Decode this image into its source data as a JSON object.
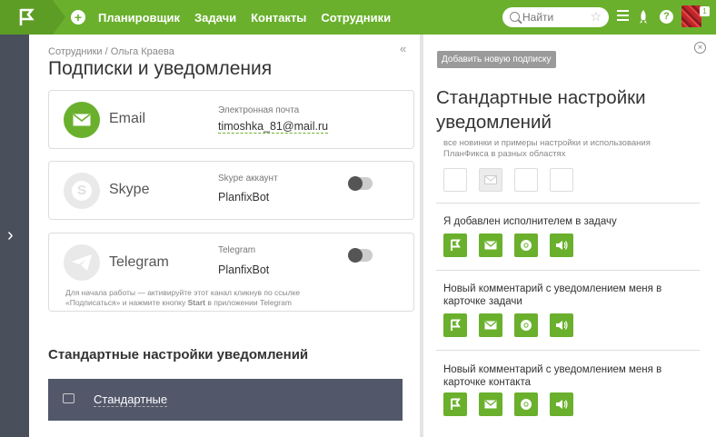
{
  "nav": {
    "items": [
      {
        "label": "Планировщик"
      },
      {
        "label": "Задачи"
      },
      {
        "label": "Контакты"
      },
      {
        "label": "Сотрудники"
      }
    ],
    "search_placeholder": "Найти",
    "avatar_badge": "1",
    "accent": "#6ab02d"
  },
  "left": {
    "breadcrumb": "Сотрудники / Ольга Краева",
    "collapse_glyph": "«",
    "title": "Подписки и уведомления",
    "email": {
      "name": "Email",
      "field_label": "Электронная почта",
      "value": "timoshka_81@mail.ru",
      "enabled": true
    },
    "skype": {
      "name": "Skype",
      "field_label": "Skype аккаунт",
      "value": "PlanfixBot",
      "enabled": false
    },
    "telegram": {
      "name": "Telegram",
      "field_label": "Telegram",
      "value": "PlanfixBot",
      "enabled": false,
      "hint_line1": "Для начала работы — активируйте этот канал кликнув по ссылке",
      "hint_line2_pre": "«Подписаться» и нажмите кнопку ",
      "hint_line2_bold": "Start",
      "hint_line2_post": " в приложении Telegram"
    },
    "section_title": "Стандартные настройки уведомлений",
    "preset_label": "Стандартные"
  },
  "right": {
    "add_button": "Добавить новую подписку",
    "title": "Стандартные настройки уведомлений",
    "description": "все новинки и примеры настройки и использования ПланФикса в разных областях",
    "notifications": [
      {
        "title": "Я добавлен исполнителем в задачу"
      },
      {
        "title": "Новый комментарий с уведомлением меня в карточке задачи"
      },
      {
        "title": "Новый комментарий с уведомлением меня в карточке контакта"
      }
    ],
    "icon_names": [
      "planfix-flag-icon",
      "mail-icon",
      "chrome-icon",
      "sound-icon"
    ]
  }
}
